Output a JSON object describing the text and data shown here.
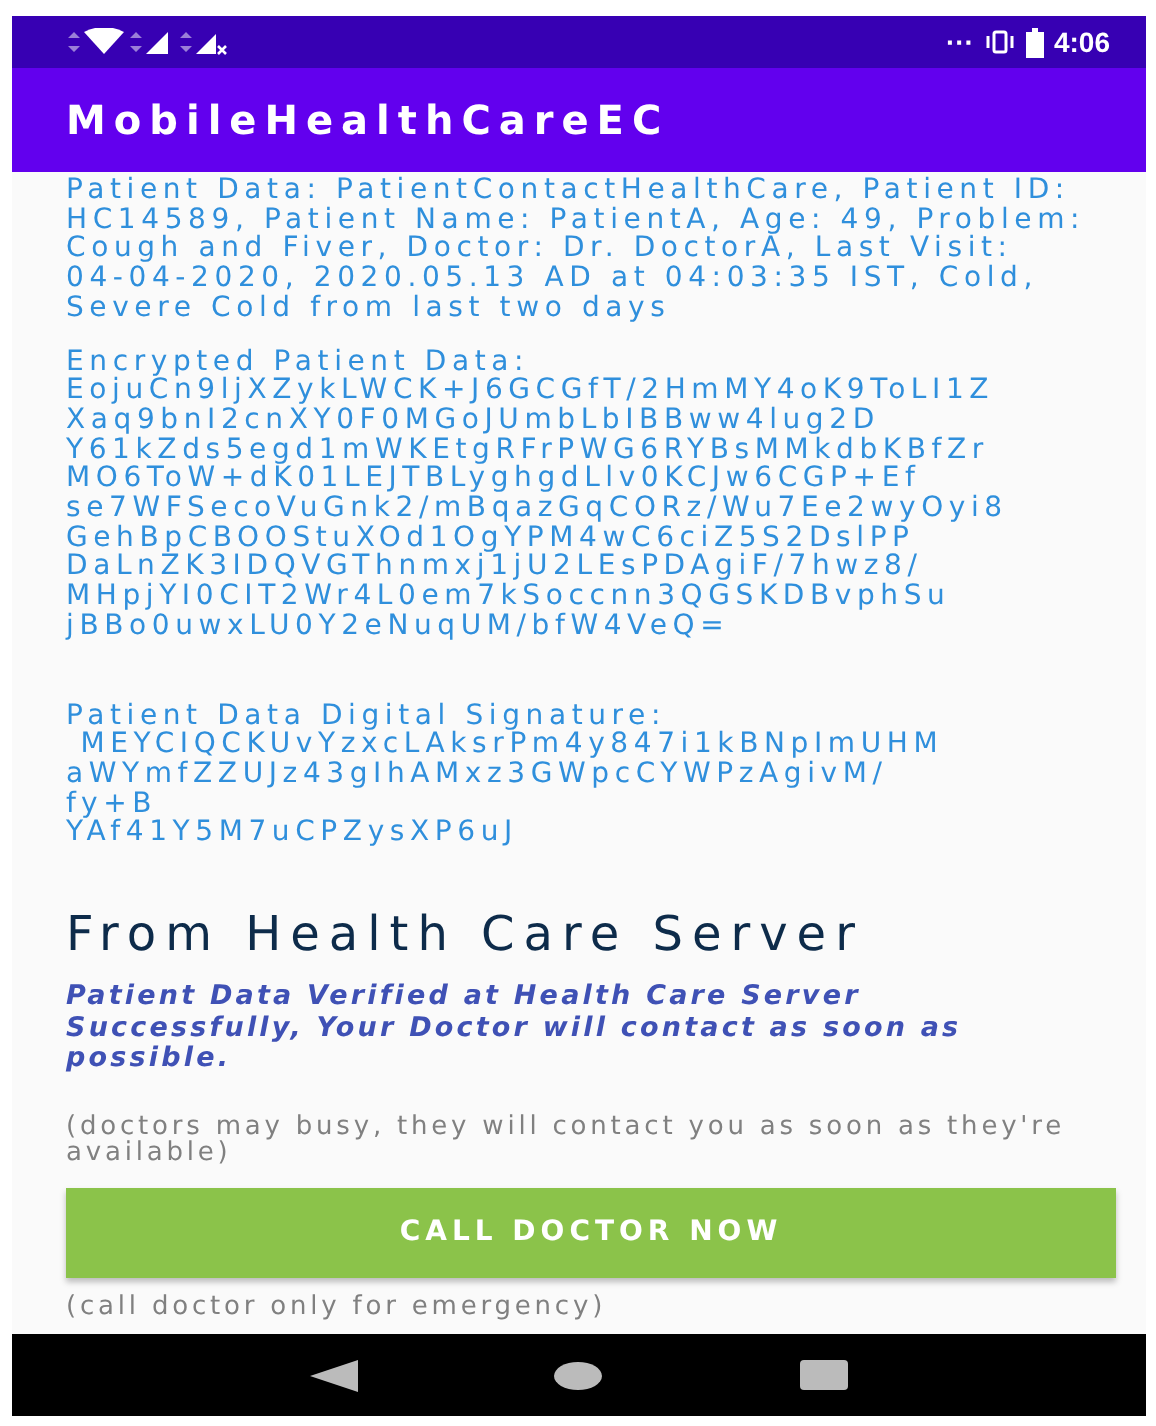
{
  "status_bar": {
    "time": "4:06",
    "overflow": "···"
  },
  "app_bar": {
    "title": "MobileHealthCareEC"
  },
  "patient_data": "Patient Data: PatientContactHealthCare, Patient ID:\nHC14589, Patient Name: PatientA, Age: 49, Problem:\nCough and Fiver, Doctor: Dr. DoctorA, Last Visit:\n04-04-2020, 2020.05.13 AD at 04:03:35 IST, Cold,\nSevere Cold from last two days",
  "encrypted_data": "Encrypted Patient Data:\nEojuCn9ljXZykLWCK+J6GCGfT/2HmMY4oK9ToLI1Z\nXaq9bnI2cnXY0F0MGoJUmbLbIBBww4lug2D\nY61kZds5egd1mWKEtgRFrPWG6RYBsMMkdbKBfZr\nMO6ToW+dK01LEJTBLyghgdLlv0KCJw6CGP+Ef\nse7WFSecoVuGnk2/mBqazGqCORz/Wu7Ee2wyOyi8\nGehBpCBOOStuXOd1OgYPM4wC6ciZ5S2DslPP\nDaLnZK3IDQVGThnmxj1jU2LEsPDAgiF/7hwz8/\nMHpjYI0CIT2Wr4L0em7kSoccnn3QGSKDBvphSu\njBBo0uwxLU0Y2eNuqUM/bfW4VeQ=",
  "signature": "Patient Data Digital Signature:\n MEYCIQCKUvYzxcLAksrPm4y847i1kBNpImUHM\naWYmfZZUJz43gIhAMxz3GWpcCYWPzAgivM/\nfy+B\nYAf41Y5M7uCPZysXP6uJ",
  "server_heading": "From Health Care Server",
  "verified_message": "Patient Data Verified at Health Care Server\nSuccessfully, Your Doctor will contact as soon as\npossible.",
  "busy_note": "(doctors may busy, they will contact you as soon as they're\navailable)",
  "call_button": "CALL DOCTOR NOW",
  "emergency_note": "(call doctor only for emergency)"
}
